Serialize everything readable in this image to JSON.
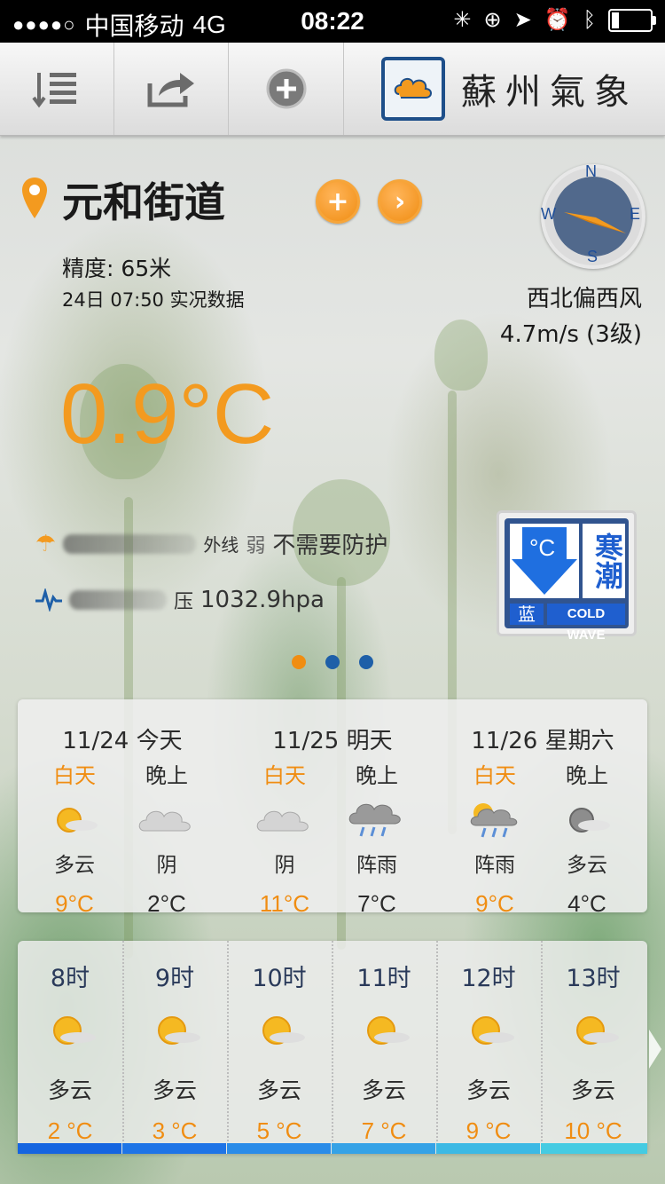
{
  "status_bar": {
    "signal": "●●●●○",
    "carrier": "中国移动",
    "network": "4G",
    "time": "08:22",
    "battery_level": 0.2
  },
  "toolbar": {
    "items": [
      "menu-list-icon",
      "share-icon",
      "add-circle-icon"
    ],
    "logo_text": "蘇州氣象"
  },
  "location": {
    "name": "元和街道",
    "precision": "精度: 65米",
    "obs_time": "24日 07:50 实况数据"
  },
  "current": {
    "temperature": "0.9°C",
    "wind_direction": "西北偏西风",
    "wind_speed": "4.7m/s (3级)",
    "compass": {
      "n": "N",
      "s": "S",
      "e": "E",
      "w": "W"
    }
  },
  "indices": {
    "uv_fragment": "外线",
    "uv_level": "弱",
    "uv_advice": "不需要防护",
    "pressure_label": "压",
    "pressure_value": "1032.9hpa"
  },
  "warning": {
    "symbol": "°C",
    "type": "寒潮",
    "level": "蓝",
    "english": "COLD WAVE",
    "color": "#1f5fcf"
  },
  "pager": {
    "total": 3,
    "active": 0
  },
  "daily": [
    {
      "date": "11/24 今天",
      "day": {
        "label": "白天",
        "cond": "多云",
        "temp": "9°C",
        "icon": "partly-cloudy-icon"
      },
      "night": {
        "label": "晚上",
        "cond": "阴",
        "temp": "2°C",
        "icon": "overcast-icon"
      }
    },
    {
      "date": "11/25 明天",
      "day": {
        "label": "白天",
        "cond": "阴",
        "temp": "11°C",
        "icon": "overcast-icon"
      },
      "night": {
        "label": "晚上",
        "cond": "阵雨",
        "temp": "7°C",
        "icon": "shower-icon"
      }
    },
    {
      "date": "11/26 星期六",
      "day": {
        "label": "白天",
        "cond": "阵雨",
        "temp": "9°C",
        "icon": "sun-shower-icon"
      },
      "night": {
        "label": "晚上",
        "cond": "多云",
        "temp": "4°C",
        "icon": "partly-cloudy-night-icon"
      }
    }
  ],
  "hourly": [
    {
      "hour": "8时",
      "cond": "多云",
      "temp": "2 °C",
      "bar_color": "#1565e0"
    },
    {
      "hour": "9时",
      "cond": "多云",
      "temp": "3 °C",
      "bar_color": "#1e74e6"
    },
    {
      "hour": "10时",
      "cond": "多云",
      "temp": "5 °C",
      "bar_color": "#2a8ce8"
    },
    {
      "hour": "11时",
      "cond": "多云",
      "temp": "7 °C",
      "bar_color": "#35a2e6"
    },
    {
      "hour": "12时",
      "cond": "多云",
      "temp": "9 °C",
      "bar_color": "#3cb9e4"
    },
    {
      "hour": "13时",
      "cond": "多云",
      "temp": "10 °C",
      "bar_color": "#45cbe2"
    }
  ],
  "colors": {
    "accent": "#f39a1f",
    "brand_blue": "#1e5fa8"
  }
}
